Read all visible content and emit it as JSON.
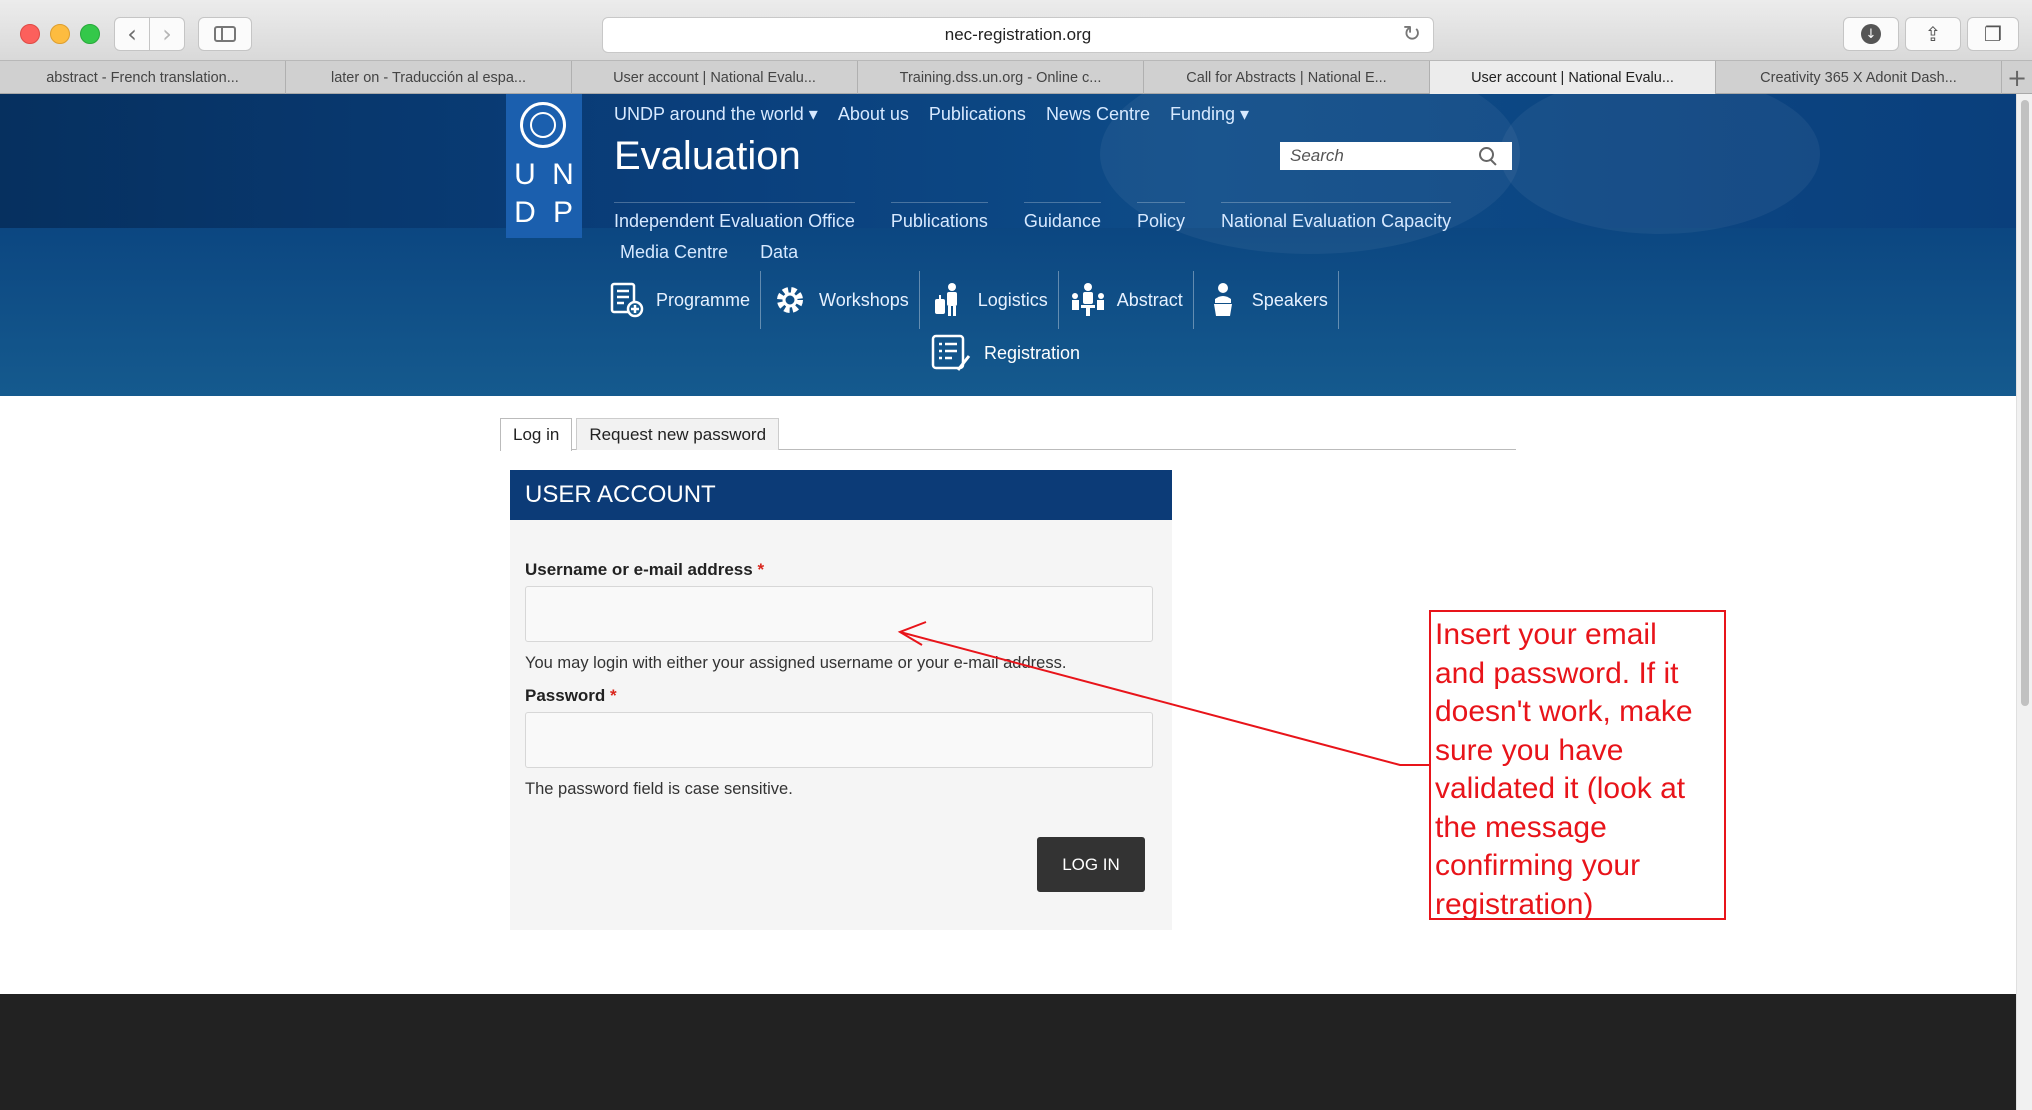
{
  "browser": {
    "url": "nec-registration.org",
    "tabs": [
      {
        "label": "abstract - French translation..."
      },
      {
        "label": "later on - Traducción al espa..."
      },
      {
        "label": "User account | National Evalu..."
      },
      {
        "label": "Training.dss.un.org - Online c..."
      },
      {
        "label": "Call for Abstracts | National E..."
      },
      {
        "label": "User account | National Evalu..."
      },
      {
        "label": "Creativity 365 X Adonit Dash..."
      }
    ],
    "active_tab_index": 5,
    "new_tab": "+"
  },
  "header": {
    "logo_letters": [
      "U",
      "N",
      "D",
      "P"
    ],
    "top_links": [
      "UNDP around the world ▾",
      "About us",
      "Publications",
      "News Centre",
      "Funding ▾"
    ],
    "site_title": "Evaluation",
    "search_placeholder": "Search",
    "main_nav": [
      "Independent Evaluation Office",
      "Publications",
      "Guidance",
      "Policy",
      "National Evaluation Capacity"
    ],
    "sub_nav": [
      "Media Centre",
      "Data"
    ],
    "event_nav": [
      {
        "label": "Programme",
        "icon": "programme-icon"
      },
      {
        "label": "Workshops",
        "icon": "gear-icon"
      },
      {
        "label": "Logistics",
        "icon": "luggage-icon"
      },
      {
        "label": "Abstract",
        "icon": "presentation-icon"
      },
      {
        "label": "Speakers",
        "icon": "speaker-icon"
      }
    ],
    "registration": {
      "label": "Registration",
      "icon": "registration-icon"
    }
  },
  "page": {
    "tabs": [
      {
        "label": "Log in",
        "active": true
      },
      {
        "label": "Request new password",
        "active": false
      }
    ],
    "card_title": "USER ACCOUNT",
    "username": {
      "label": "Username or e-mail address",
      "required_mark": "*",
      "value": "",
      "help": "You may login with either your assigned username or your e-mail address."
    },
    "password": {
      "label": "Password",
      "required_mark": "*",
      "value": "",
      "help": "The password field is case sensitive."
    },
    "submit_label": "LOG IN"
  },
  "annotation": {
    "lines": [
      "Insert your email",
      "and password. If it",
      "doesn't work, make",
      "sure you have",
      "validated it (look at",
      "the message",
      "confirming your",
      "registration)"
    ],
    "color": "#e8141a"
  },
  "colors": {
    "header_blue": "#0c3b77",
    "logo_blue": "#1b5fae",
    "button_dark": "#333333",
    "footer": "#222222"
  }
}
